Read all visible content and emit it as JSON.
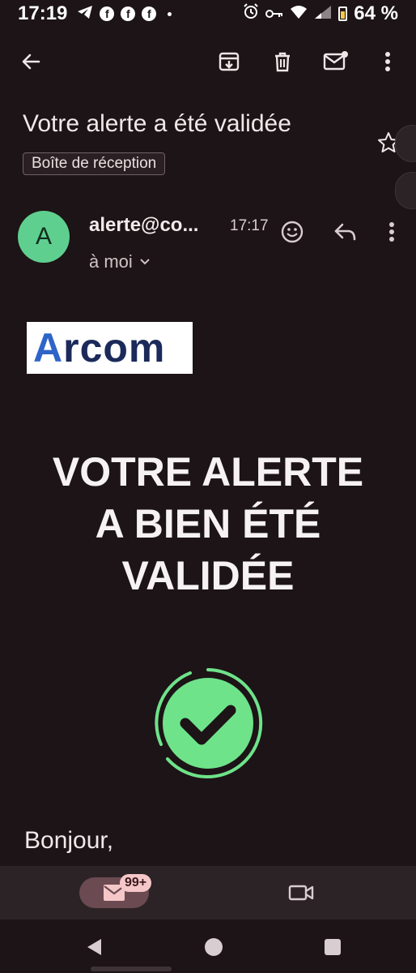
{
  "status_bar": {
    "time": "17:19",
    "notification_icons": [
      "telegram-icon",
      "facebook-icon",
      "facebook-icon",
      "facebook-icon"
    ],
    "system_icons": [
      "alarm-icon",
      "vpn-key-icon",
      "wifi-icon",
      "signal-icon",
      "battery-icon"
    ],
    "battery_percent": "64 %",
    "battery_level": 0.64
  },
  "toolbar": {
    "actions": [
      "back-icon",
      "archive-icon",
      "delete-icon",
      "mark-unread-icon",
      "more-icon"
    ]
  },
  "email": {
    "subject": "Votre alerte a été validée",
    "label": "Boîte de réception",
    "sender_initial": "A",
    "sender": "alerte@co...",
    "time": "17:17",
    "recipient": "à moi"
  },
  "body": {
    "logo_text_accent": "A",
    "logo_text_rest": "rcom",
    "headline_lines": [
      "VOTRE ALERTE",
      "A BIEN ÉTÉ",
      "VALIDÉE"
    ],
    "greeting": "Bonjour,"
  },
  "bottom_nav": {
    "mail_badge": "99+"
  },
  "colors": {
    "background": "#1c1416",
    "avatar": "#5fcf8f",
    "check_green": "#6ee38a",
    "nav_pill": "#6b4a52",
    "badge": "#f6c7c8"
  }
}
